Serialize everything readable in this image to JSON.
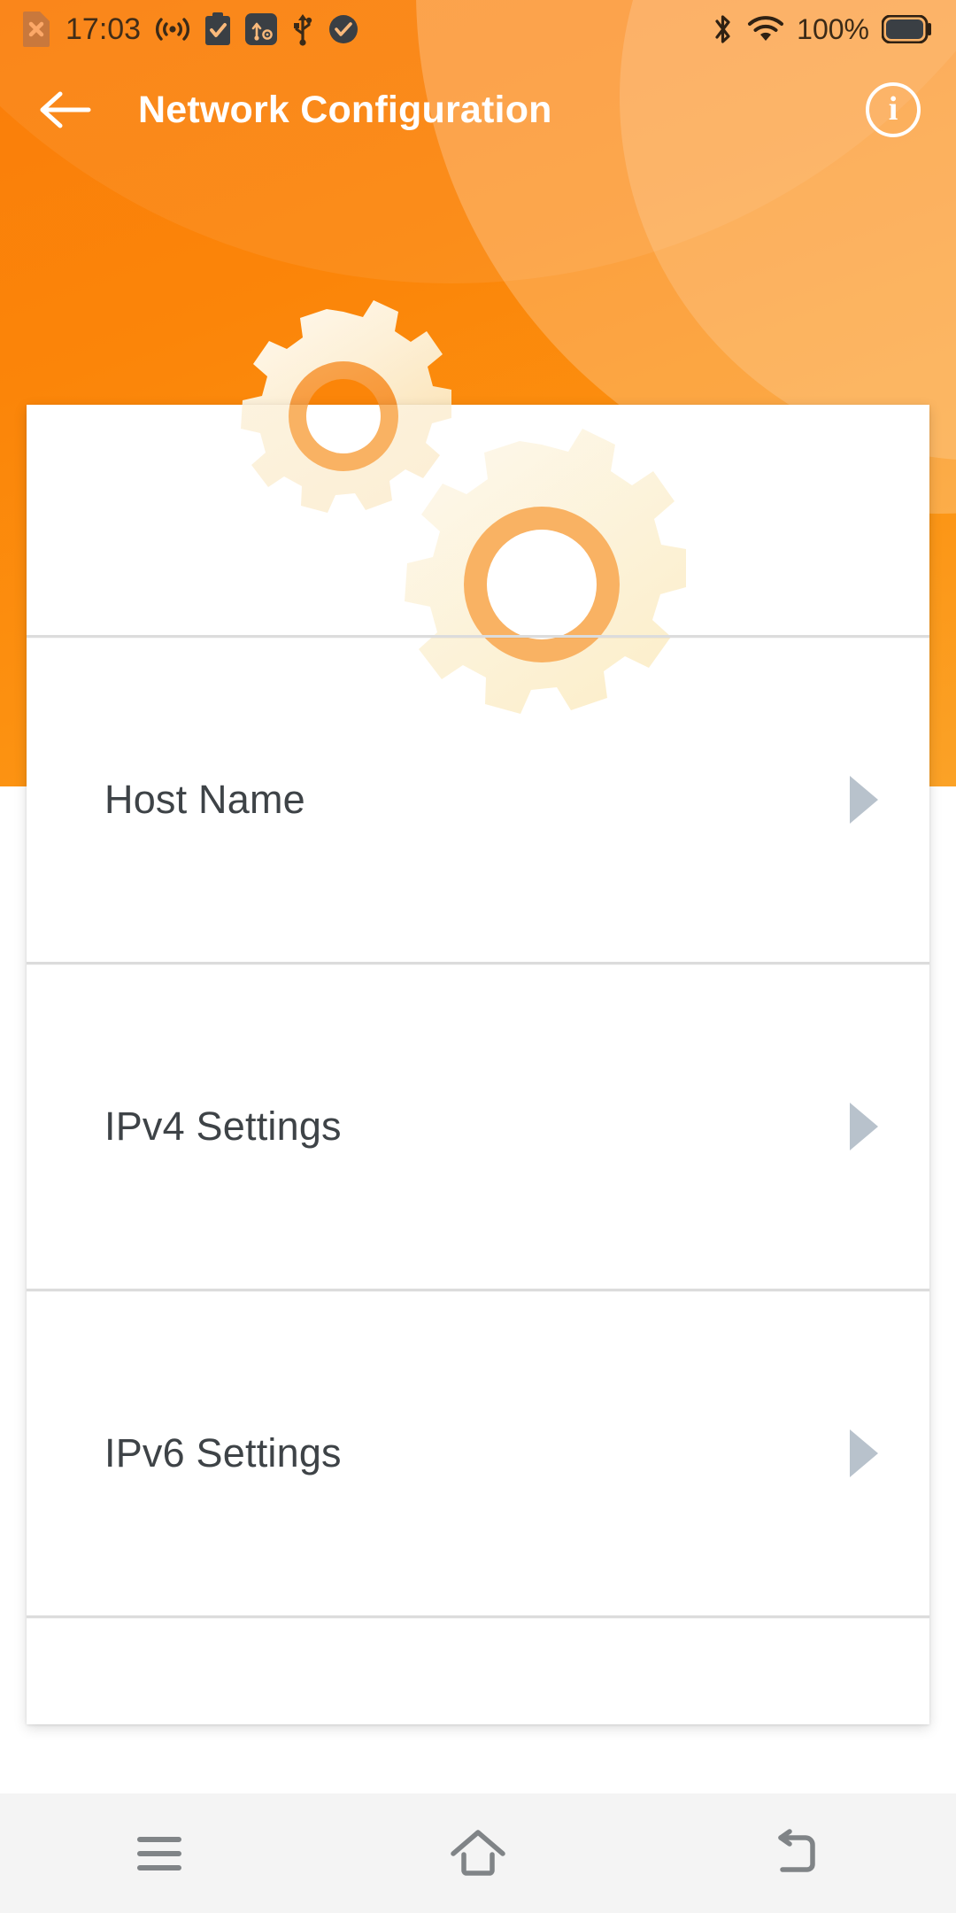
{
  "status_bar": {
    "time": "17:03",
    "battery_percent": "100%",
    "icons_left": [
      "sim-card-error-icon",
      "cast-wireless-icon",
      "clipboard-check-icon",
      "usb-settings-icon",
      "usb-icon",
      "check-circle-icon"
    ],
    "icons_right": [
      "bluetooth-icon",
      "wifi-icon",
      "battery-full-icon"
    ]
  },
  "app_bar": {
    "title": "Network Configuration",
    "back_icon": "arrow-left-icon",
    "info_icon": "info-circle-icon",
    "info_glyph": "i"
  },
  "hero": {
    "illustration": "settings-gears-illustration",
    "background_color": "#fb8509",
    "gear_fill": "#fdf0d6",
    "gear_hub_color": "#f79a3c"
  },
  "list": {
    "rows": [
      {
        "label": "Host Name",
        "arrow_icon": "chevron-right-icon"
      },
      {
        "label": "IPv4 Settings",
        "arrow_icon": "chevron-right-icon"
      },
      {
        "label": "IPv6 Settings",
        "arrow_icon": "chevron-right-icon"
      }
    ]
  },
  "nav_bar": {
    "buttons": [
      {
        "name": "recents-button",
        "icon": "menu-lines-icon"
      },
      {
        "name": "home-button",
        "icon": "home-icon"
      },
      {
        "name": "back-button",
        "icon": "back-arrow-icon"
      }
    ]
  },
  "colors": {
    "accent": "#fb8509",
    "card": "#ffffff",
    "divider": "#dcdcdc",
    "text": "#3e4347",
    "arrow": "#b8c2cc",
    "navbar": "#f4f4f4"
  }
}
